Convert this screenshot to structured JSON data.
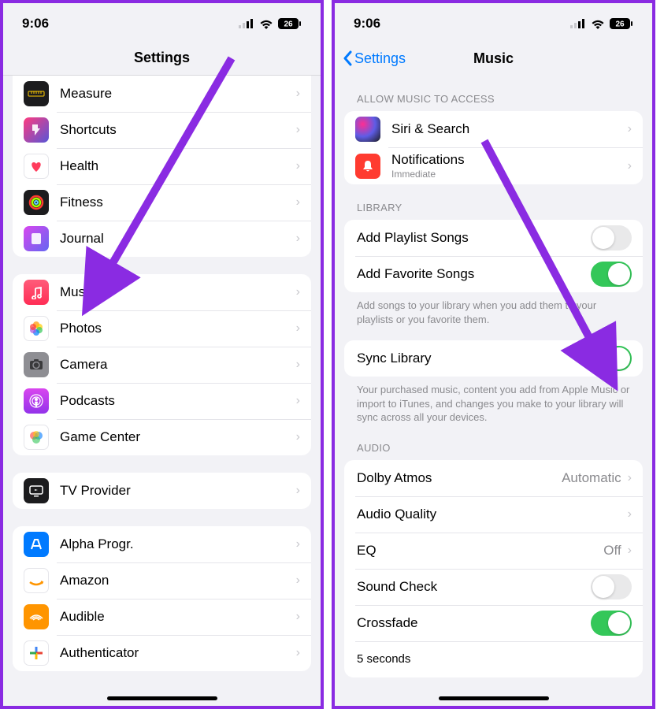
{
  "status": {
    "time": "9:06",
    "battery": "26"
  },
  "left": {
    "title": "Settings",
    "section1": [
      {
        "label": "Measure"
      },
      {
        "label": "Shortcuts"
      },
      {
        "label": "Health"
      },
      {
        "label": "Fitness"
      },
      {
        "label": "Journal"
      }
    ],
    "section2": [
      {
        "label": "Music"
      },
      {
        "label": "Photos"
      },
      {
        "label": "Camera"
      },
      {
        "label": "Podcasts"
      },
      {
        "label": "Game Center"
      }
    ],
    "section3": [
      {
        "label": "TV Provider"
      }
    ],
    "section4": [
      {
        "label": "Alpha Progr."
      },
      {
        "label": "Amazon"
      },
      {
        "label": "Audible"
      },
      {
        "label": "Authenticator"
      }
    ]
  },
  "right": {
    "back": "Settings",
    "title": "Music",
    "allow_header": "Allow Music to Access",
    "allow": [
      {
        "label": "Siri & Search"
      },
      {
        "label": "Notifications",
        "sublabel": "Immediate"
      }
    ],
    "library_header": "Library",
    "library": {
      "add_playlist": {
        "label": "Add Playlist Songs",
        "on": false
      },
      "add_favorite": {
        "label": "Add Favorite Songs",
        "on": true
      },
      "footer1": "Add songs to your library when you add them to your playlists or you favorite them.",
      "sync": {
        "label": "Sync Library",
        "on": true
      },
      "footer2": "Your purchased music, content you add from Apple Music or import to iTunes, and changes you make to your library will sync across all your devices."
    },
    "audio_header": "Audio",
    "audio": {
      "dolby": {
        "label": "Dolby Atmos",
        "value": "Automatic"
      },
      "quality": {
        "label": "Audio Quality"
      },
      "eq": {
        "label": "EQ",
        "value": "Off"
      },
      "soundcheck": {
        "label": "Sound Check",
        "on": false
      },
      "crossfade": {
        "label": "Crossfade",
        "on": true
      },
      "crossfade_time": "5 seconds"
    }
  }
}
